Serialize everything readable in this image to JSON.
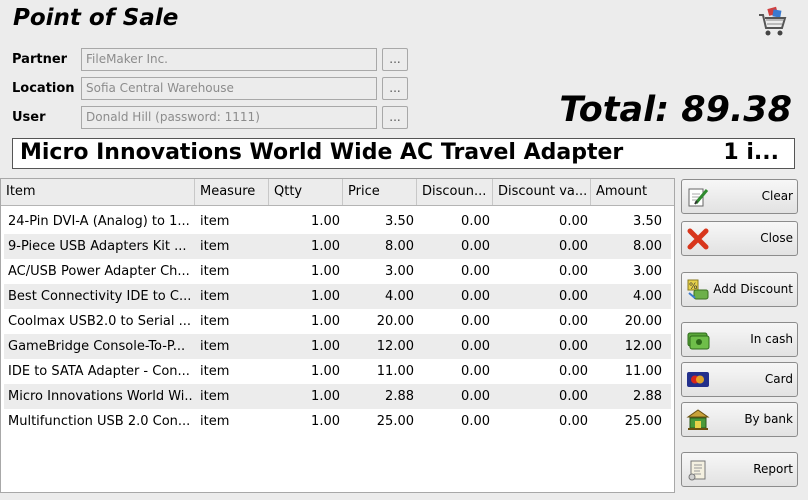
{
  "header": {
    "title": "Point of Sale",
    "cart_icon": "shopping-cart-icon"
  },
  "fields": [
    {
      "label": "Partner",
      "value": "FileMaker Inc.",
      "button": "..."
    },
    {
      "label": "Location",
      "value": "Sofia Central Warehouse",
      "button": "..."
    },
    {
      "label": "User",
      "value": "Donald Hill (password: 1111)",
      "button": "..."
    }
  ],
  "total": "Total: 89.38",
  "banner": {
    "name": "Micro Innovations World Wide AC Travel Adapter",
    "qty": "1 i..."
  },
  "table": {
    "columns": [
      "Item",
      "Measure",
      "Qtty",
      "Price",
      "Discoun...",
      "Discount va...",
      "Amount"
    ],
    "rows": [
      [
        "24-Pin DVI-A (Analog) to 1...",
        "item",
        "1.00",
        "3.50",
        "0.00",
        "0.00",
        "3.50"
      ],
      [
        "9-Piece USB Adapters Kit ...",
        "item",
        "1.00",
        "8.00",
        "0.00",
        "0.00",
        "8.00"
      ],
      [
        "AC/USB Power Adapter Ch...",
        "item",
        "1.00",
        "3.00",
        "0.00",
        "0.00",
        "3.00"
      ],
      [
        "Best Connectivity IDE to C...",
        "item",
        "1.00",
        "4.00",
        "0.00",
        "0.00",
        "4.00"
      ],
      [
        "Coolmax USB2.0 to Serial ...",
        "item",
        "1.00",
        "20.00",
        "0.00",
        "0.00",
        "20.00"
      ],
      [
        "GameBridge Console-To-P...",
        "item",
        "1.00",
        "12.00",
        "0.00",
        "0.00",
        "12.00"
      ],
      [
        "IDE to SATA Adapter - Con...",
        "item",
        "1.00",
        "11.00",
        "0.00",
        "0.00",
        "11.00"
      ],
      [
        "Micro Innovations World Wi...",
        "item",
        "1.00",
        "2.88",
        "0.00",
        "0.00",
        "2.88"
      ],
      [
        "Multifunction USB 2.0 Con...",
        "item",
        "1.00",
        "25.00",
        "0.00",
        "0.00",
        "25.00"
      ]
    ]
  },
  "actions": [
    {
      "label": "Clear",
      "icon": "clear-icon"
    },
    {
      "label": "Close",
      "icon": "close-icon"
    },
    {
      "label": "Add Discount",
      "icon": "discount-icon"
    },
    {
      "label": "In cash",
      "icon": "cash-icon"
    },
    {
      "label": "Card",
      "icon": "card-icon"
    },
    {
      "label": "By bank",
      "icon": "bank-icon"
    },
    {
      "label": "Report",
      "icon": "report-icon"
    }
  ]
}
